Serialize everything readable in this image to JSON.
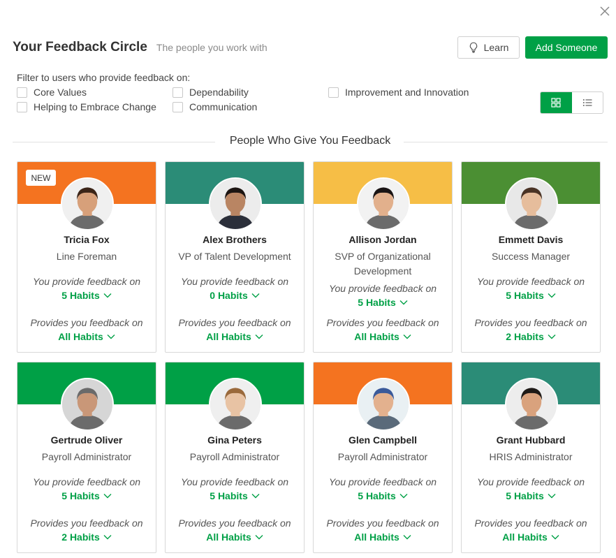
{
  "header": {
    "title": "Your Feedback Circle",
    "subtitle": "The people you work with",
    "learn_label": "Learn",
    "add_label": "Add Someone"
  },
  "filters": {
    "label": "Filter to users who provide feedback on:",
    "options": [
      "Core Values",
      "Dependability",
      "Improvement and Innovation",
      "Helping to Embrace Change",
      "Communication"
    ]
  },
  "view_toggle": {
    "active": "grid",
    "icons": [
      "grid-icon",
      "list-icon"
    ]
  },
  "section_title": "People Who Give You Feedback",
  "card_labels": {
    "you_provide": "You provide feedback on",
    "provides_you": "Provides you feedback on"
  },
  "new_badge": "NEW",
  "colors": {
    "accent": "#00a046",
    "orange": "#f47320",
    "teal": "#2b8c77",
    "yellow": "#f6be46",
    "olive": "#4b8f33",
    "green": "#00a046"
  },
  "people": [
    {
      "name": "Tricia Fox",
      "role": "Line Foreman",
      "you_provide": "5 Habits",
      "provides_you": "All Habits",
      "band": "#f47320",
      "is_new": true
    },
    {
      "name": "Alex Brothers",
      "role": "VP of Talent Development",
      "you_provide": "0 Habits",
      "provides_you": "All Habits",
      "band": "#2b8c77",
      "is_new": false
    },
    {
      "name": "Allison Jordan",
      "role": "SVP of Organizational Development",
      "you_provide": "5 Habits",
      "provides_you": "All Habits",
      "band": "#f6be46",
      "is_new": false
    },
    {
      "name": "Emmett Davis",
      "role": "Success Manager",
      "you_provide": "5 Habits",
      "provides_you": "2 Habits",
      "band": "#4b8f33",
      "is_new": false
    },
    {
      "name": "Gertrude Oliver",
      "role": "Payroll Administrator",
      "you_provide": "5 Habits",
      "provides_you": "2 Habits",
      "band": "#00a046",
      "is_new": false
    },
    {
      "name": "Gina Peters",
      "role": "Payroll Administrator",
      "you_provide": "5 Habits",
      "provides_you": "All Habits",
      "band": "#00a046",
      "is_new": false
    },
    {
      "name": "Glen Campbell",
      "role": "Payroll Administrator",
      "you_provide": "5 Habits",
      "provides_you": "All Habits",
      "band": "#f47320",
      "is_new": false
    },
    {
      "name": "Grant Hubbard",
      "role": "HRIS Administrator",
      "you_provide": "5 Habits",
      "provides_you": "All Habits",
      "band": "#2b8c77",
      "is_new": false
    }
  ]
}
